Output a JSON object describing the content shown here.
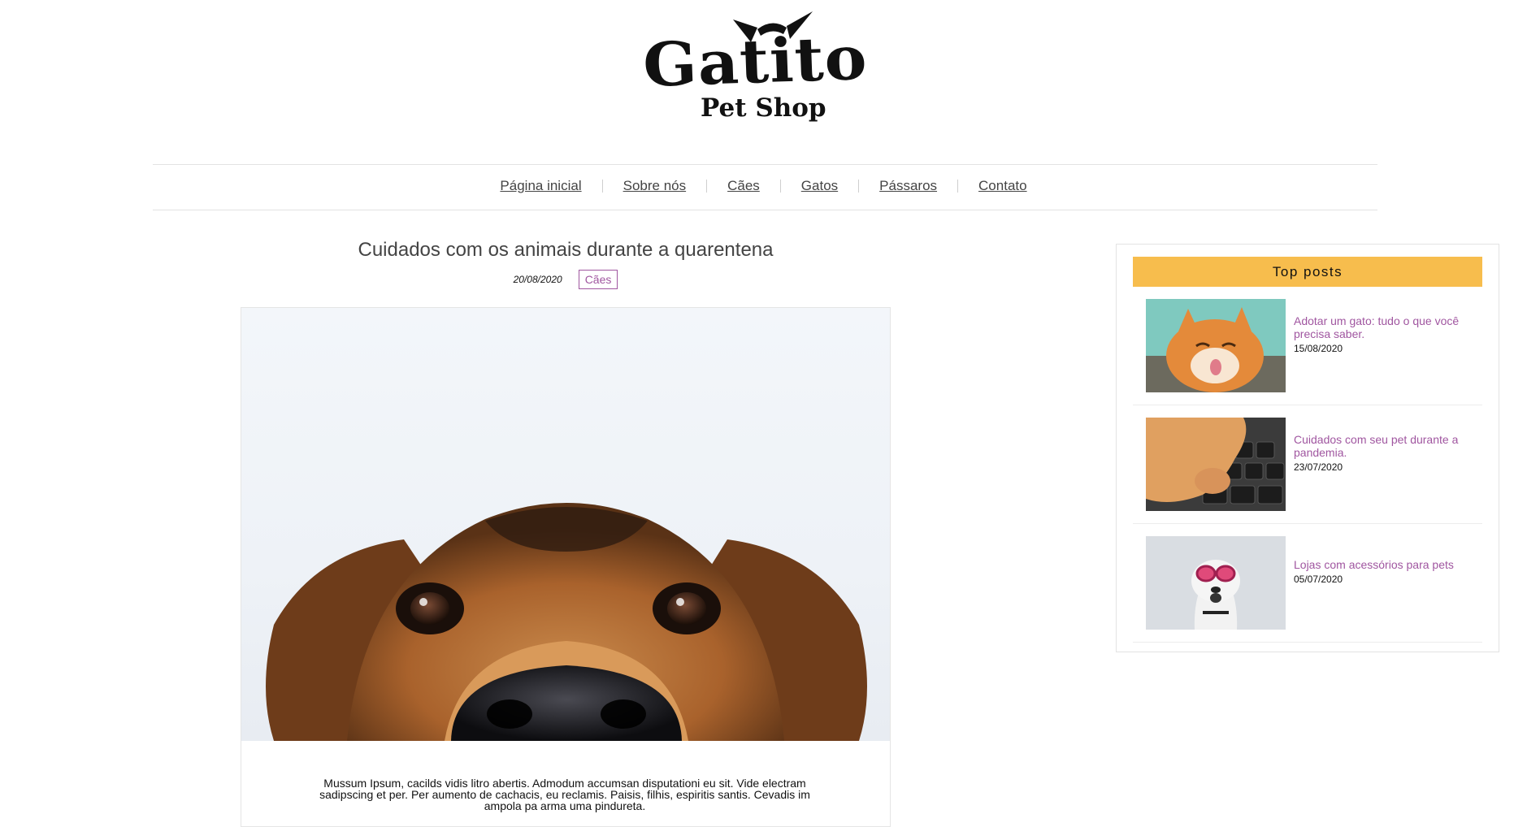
{
  "brand": {
    "name": "Gatito",
    "tagline": "Pet Shop"
  },
  "nav": {
    "items": [
      {
        "label": "Página inicial"
      },
      {
        "label": "Sobre nós"
      },
      {
        "label": "Cães"
      },
      {
        "label": "Gatos"
      },
      {
        "label": "Pássaros"
      },
      {
        "label": "Contato"
      }
    ]
  },
  "post": {
    "title": "Cuidados com os animais durante a quarentena",
    "date": "20/08/2020",
    "category": "Cães",
    "image_icon": "dog-photo",
    "body": "Mussum Ipsum, cacilds vidis litro abertis. Admodum accumsan disputationi eu sit. Vide electram sadipscing et per. Per aumento de cachacis, eu reclamis. Paisis, filhis, espiritis santis. Cevadis im ampola pa arma uma pindureta."
  },
  "sidebar": {
    "title": "Top posts",
    "items": [
      {
        "title": "Adotar um gato: tudo o que você precisa saber.",
        "date": "15/08/2020",
        "thumb_icon": "cat-photo"
      },
      {
        "title": "Cuidados com seu pet durante a pandemia.",
        "date": "23/07/2020",
        "thumb_icon": "cat-paw-keyboard-photo"
      },
      {
        "title": "Lojas com acessórios para pets",
        "date": "05/07/2020",
        "thumb_icon": "dog-goggles-photo"
      }
    ]
  },
  "colors": {
    "accent": "#a056a0",
    "sidebar_header": "#f7bd4d"
  }
}
